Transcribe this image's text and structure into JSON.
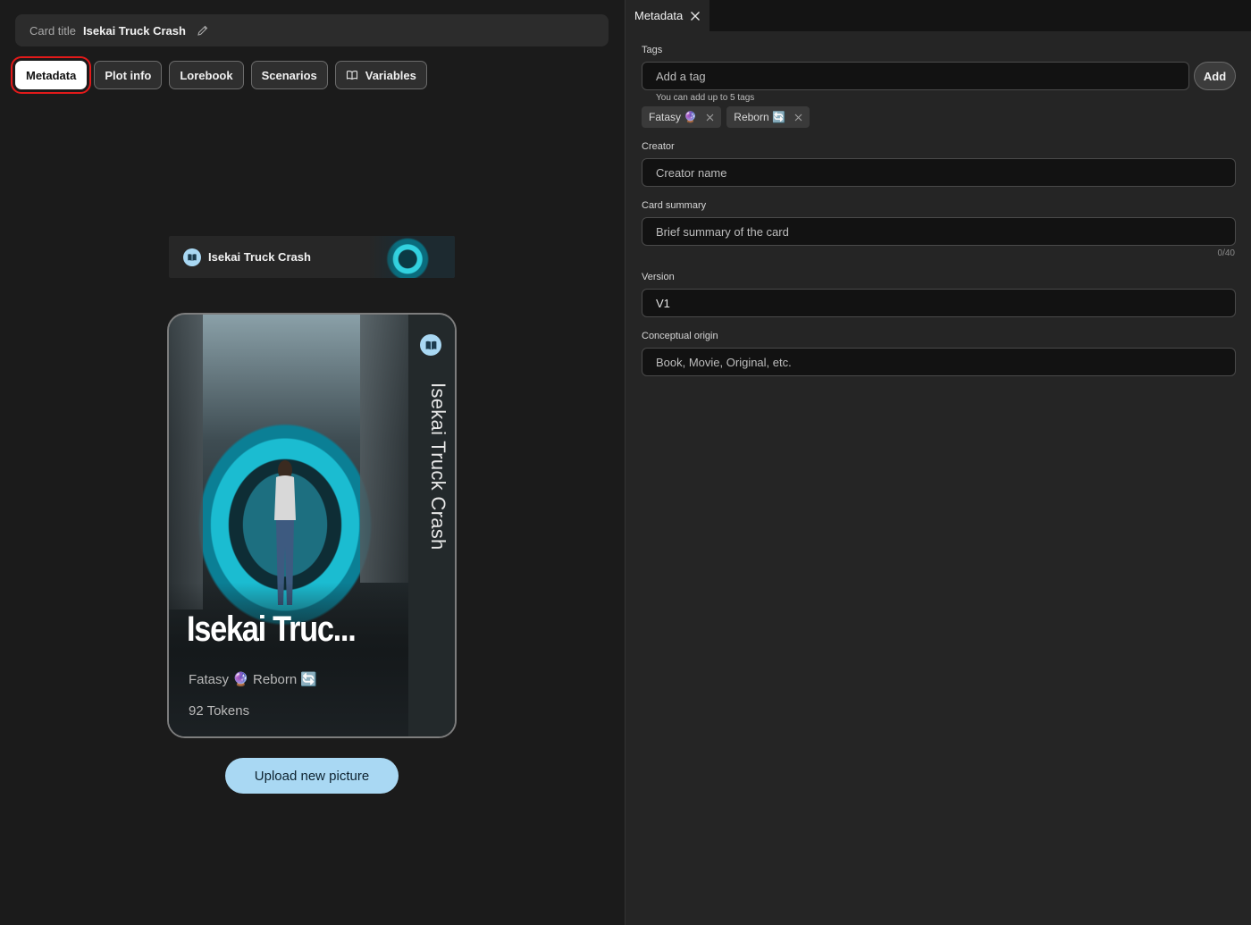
{
  "header": {
    "card_title_label": "Card title",
    "card_title_value": "Isekai Truck Crash"
  },
  "tabs": [
    {
      "label": "Metadata",
      "active": true
    },
    {
      "label": "Plot info",
      "active": false
    },
    {
      "label": "Lorebook",
      "active": false
    },
    {
      "label": "Scenarios",
      "active": false
    },
    {
      "label": "Variables",
      "active": false,
      "icon": "book-icon"
    }
  ],
  "banner": {
    "title": "Isekai Truck Crash",
    "icon": "book-icon"
  },
  "card": {
    "vertical_title": "Isekai Truck Crash",
    "big_title": "Isekai Truc...",
    "tags_line": "Fatasy 🔮 Reborn 🔄",
    "tokens": "92 Tokens",
    "icon": "book-icon"
  },
  "upload_button": "Upload new picture",
  "panel": {
    "tab_label": "Metadata",
    "tags": {
      "label": "Tags",
      "placeholder": "Add a tag",
      "add_label": "Add",
      "hint": "You can add up to 5 tags",
      "chips": [
        "Fatasy 🔮",
        "Reborn 🔄"
      ]
    },
    "creator": {
      "label": "Creator",
      "placeholder": "Creator name"
    },
    "summary": {
      "label": "Card summary",
      "placeholder": "Brief summary of the card",
      "counter": "0/40"
    },
    "version": {
      "label": "Version",
      "value": "V1"
    },
    "origin": {
      "label": "Conceptual origin",
      "placeholder": "Book, Movie, Original, etc."
    }
  },
  "colors": {
    "accent": "#a9d8f3",
    "highlight_outline": "#e21a1a",
    "background": "#1b1b1b",
    "panel": "#252525"
  }
}
